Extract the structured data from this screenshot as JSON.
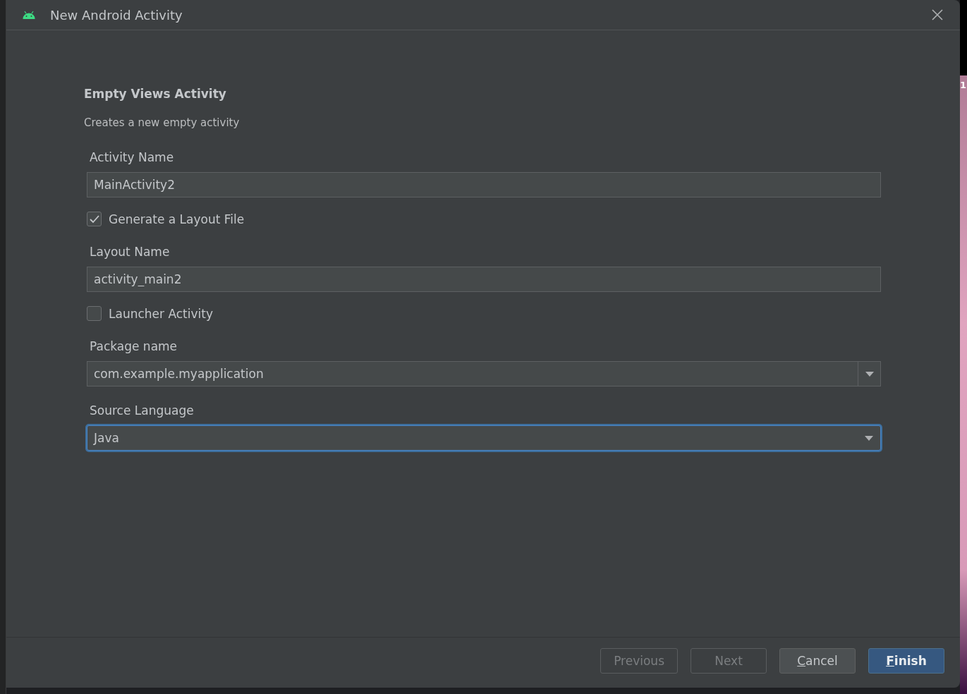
{
  "window": {
    "title": "New Android Activity"
  },
  "template": {
    "title": "Empty Views Activity",
    "description": "Creates a new empty activity"
  },
  "fields": [
    {
      "kind": "text",
      "label": "Activity Name",
      "value": "MainActivity2"
    },
    {
      "kind": "checkbox",
      "label": "Generate a Layout File",
      "checked": true
    },
    {
      "kind": "text",
      "label": "Layout Name",
      "value": "activity_main2"
    },
    {
      "kind": "checkbox",
      "label": "Launcher Activity",
      "checked": false
    },
    {
      "kind": "combo",
      "label": "Package name",
      "value": "com.example.myapplication",
      "focused": false
    },
    {
      "kind": "select",
      "label": "Source Language",
      "value": "Java",
      "focused": true
    }
  ],
  "buttons": [
    {
      "label": "Previous",
      "disabled": true,
      "default": false,
      "mnemonic": false
    },
    {
      "label": "Next",
      "disabled": true,
      "default": false,
      "mnemonic": false
    },
    {
      "label": "Cancel",
      "disabled": false,
      "default": false,
      "mnemonic": true
    },
    {
      "label": "Finish",
      "disabled": false,
      "default": true,
      "mnemonic": true
    }
  ],
  "background": {
    "edge_text": "1"
  }
}
